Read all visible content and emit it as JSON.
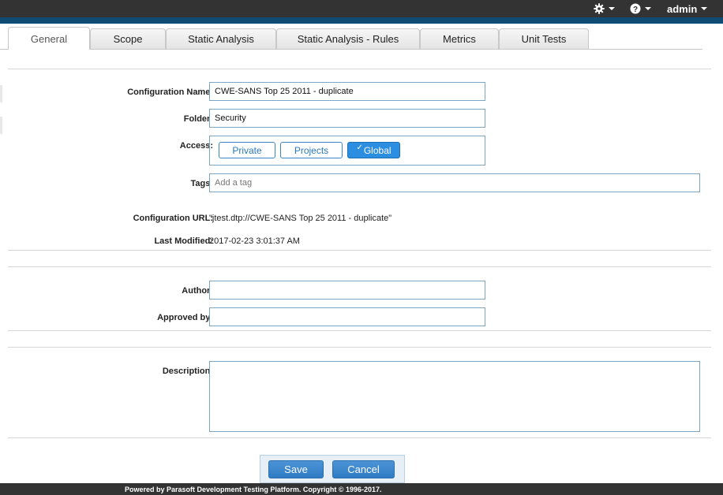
{
  "topbar": {
    "gear_icon": "gear-icon",
    "help_icon": "help-icon",
    "user_label": "admin"
  },
  "tabs": [
    {
      "label": "General",
      "active": true
    },
    {
      "label": "Scope",
      "active": false
    },
    {
      "label": "Static Analysis",
      "active": false
    },
    {
      "label": "Static Analysis - Rules",
      "active": false
    },
    {
      "label": "Metrics",
      "active": false
    },
    {
      "label": "Unit Tests",
      "active": false
    }
  ],
  "general": {
    "configuration_name_label": "Configuration Name:",
    "configuration_name_value": "CWE-SANS Top 25 2011 - duplicate",
    "folder_label": "Folder:",
    "folder_value": "Security",
    "access_label": "Access:",
    "access_options": [
      "Private",
      "Projects",
      "Global"
    ],
    "access_selected": "Global",
    "access_check": "✓",
    "tags_label": "Tags:",
    "tags_placeholder": "Add a tag",
    "config_url_label": "Configuration URL:",
    "config_url_value": "\"jtest.dtp://CWE-SANS Top 25 2011 - duplicate\"",
    "last_modified_label": "Last Modified:",
    "last_modified_value": "2017-02-23 3:01:37 AM"
  },
  "authorship": {
    "author_label": "Author:",
    "author_value": "",
    "approved_by_label": "Approved by:",
    "approved_by_value": ""
  },
  "description": {
    "label": "Description:",
    "value": ""
  },
  "actions": {
    "save_label": "Save",
    "cancel_label": "Cancel"
  },
  "footer": {
    "text": "Powered by Parasoft Development Testing Platform. Copyright © 1996-2017."
  },
  "colors": {
    "accent": "#2b8ee0",
    "topbar": "#333333",
    "stripe": "#0f4b73"
  }
}
